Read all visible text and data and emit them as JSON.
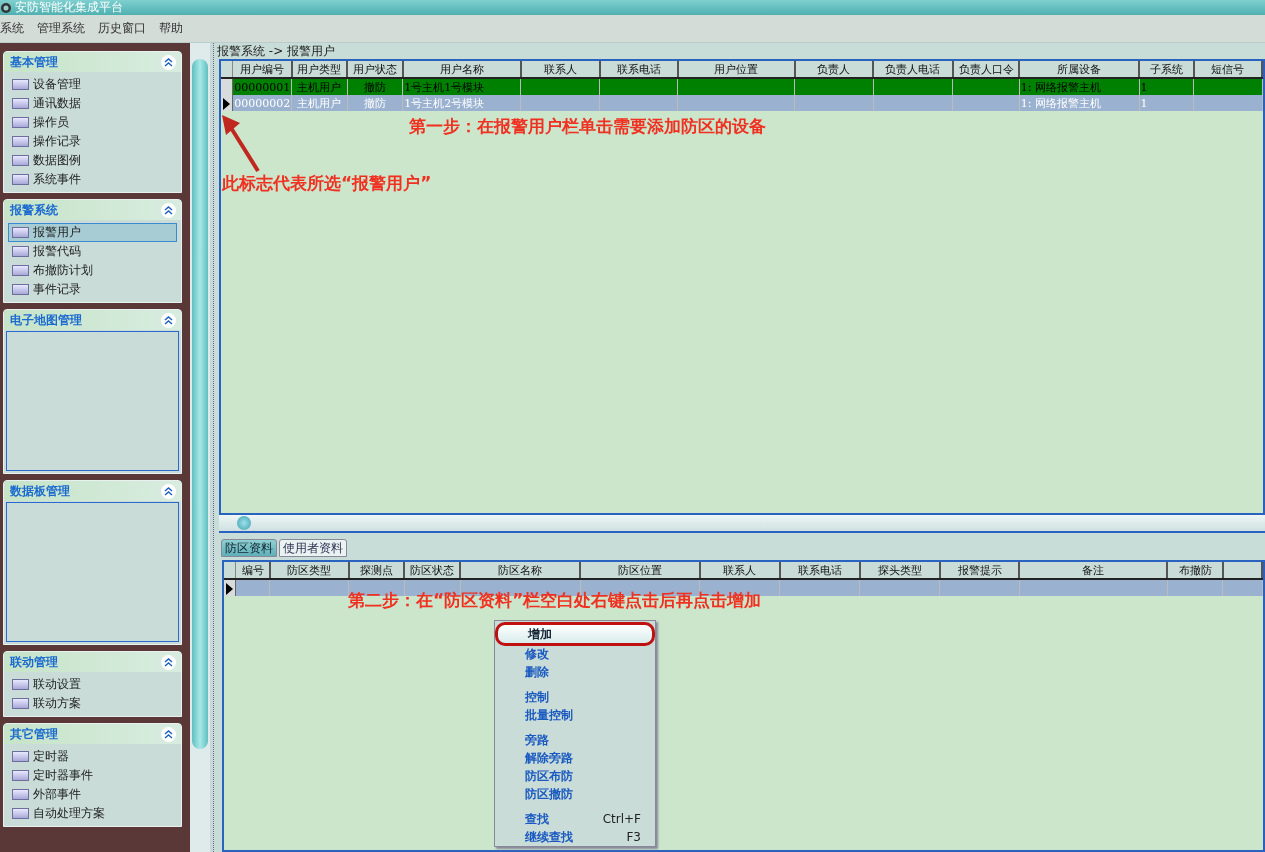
{
  "window": {
    "title": "安防智能化集成平台"
  },
  "menu": [
    "系统",
    "管理系统",
    "历史窗口",
    "帮助"
  ],
  "sidebar": [
    {
      "title": "基本管理",
      "kind": "list",
      "items": [
        {
          "label": "设备管理",
          "selected": false
        },
        {
          "label": "通讯数据",
          "selected": false
        },
        {
          "label": "操作员",
          "selected": false
        },
        {
          "label": "操作记录",
          "selected": false
        },
        {
          "label": "数据图例",
          "selected": false
        },
        {
          "label": "系统事件",
          "selected": false
        }
      ]
    },
    {
      "title": "报警系统",
      "kind": "list",
      "items": [
        {
          "label": "报警用户",
          "selected": true
        },
        {
          "label": "报警代码",
          "selected": false
        },
        {
          "label": "布撤防计划",
          "selected": false
        },
        {
          "label": "事件记录",
          "selected": false
        }
      ]
    },
    {
      "title": "电子地图管理",
      "kind": "empty"
    },
    {
      "title": "数据板管理",
      "kind": "empty"
    },
    {
      "title": "联动管理",
      "kind": "list",
      "items": [
        {
          "label": "联动设置",
          "selected": false
        },
        {
          "label": "联动方案",
          "selected": false
        }
      ]
    },
    {
      "title": "其它管理",
      "kind": "list",
      "items": [
        {
          "label": "定时器",
          "selected": false
        },
        {
          "label": "定时器事件",
          "selected": false
        },
        {
          "label": "外部事件",
          "selected": false
        },
        {
          "label": "自动处理方案",
          "selected": false
        }
      ]
    }
  ],
  "breadcrumb": "报警系统 -> 报警用户",
  "users_table": {
    "columns": [
      "用户编号",
      "用户类型",
      "用户状态",
      "用户名称",
      "联系人",
      "联系电话",
      "用户位置",
      "负责人",
      "负责人电话",
      "负责人口令",
      "所属设备",
      "子系统",
      "短信号"
    ],
    "rows": [
      {
        "current": false,
        "color": "#008000",
        "cells": [
          "00000001",
          "主机用户",
          "撤防",
          "1号主机1号模块",
          "",
          "",
          "",
          "",
          "",
          "",
          "1: 网络报警主机",
          "1",
          ""
        ]
      },
      {
        "current": true,
        "color": "#9ab2d0",
        "cells": [
          "00000002",
          "主机用户",
          "撤防",
          "1号主机2号模块",
          "",
          "",
          "",
          "",
          "",
          "",
          "1: 网络报警主机",
          "1",
          ""
        ]
      }
    ]
  },
  "tabs": [
    {
      "label": "防区资料",
      "selected": true
    },
    {
      "label": "使用者资料",
      "selected": false
    }
  ],
  "zones_table": {
    "columns": [
      "编号",
      "防区类型",
      "探测点",
      "防区状态",
      "防区名称",
      "防区位置",
      "联系人",
      "联系电话",
      "探头类型",
      "报警提示",
      "备注",
      "布撤防",
      ""
    ],
    "rows": [
      {
        "current": true,
        "color": "#9ab2d0",
        "cells": [
          "",
          "",
          "",
          "",
          "",
          "",
          "",
          "",
          "",
          "",
          "",
          "",
          ""
        ]
      }
    ]
  },
  "context_menu": {
    "items": [
      {
        "kind": "item",
        "label": "增加",
        "selected": true
      },
      {
        "kind": "item",
        "label": "修改",
        "selected": false
      },
      {
        "kind": "item",
        "label": "删除",
        "selected": false
      },
      {
        "kind": "separator"
      },
      {
        "kind": "item",
        "label": "控制",
        "selected": false
      },
      {
        "kind": "item",
        "label": "批量控制",
        "selected": false
      },
      {
        "kind": "separator"
      },
      {
        "kind": "item",
        "label": "旁路",
        "selected": false
      },
      {
        "kind": "item",
        "label": "解除旁路",
        "selected": false
      },
      {
        "kind": "item",
        "label": "防区布防",
        "selected": false
      },
      {
        "kind": "item",
        "label": "防区撤防",
        "selected": false
      },
      {
        "kind": "separator"
      },
      {
        "kind": "item",
        "label": "查找",
        "shortcut": "Ctrl+F",
        "selected": false
      },
      {
        "kind": "item",
        "label": "继续查找",
        "shortcut": "F3",
        "selected": false
      }
    ]
  },
  "annotations": {
    "marker_note": "此标志代表所选“报警用户”",
    "step1": "第一步：在报警用户栏单击需要添加防区的设备",
    "step2": "第二步：在“防区资料”栏空白处右键点击后再点击增加"
  }
}
